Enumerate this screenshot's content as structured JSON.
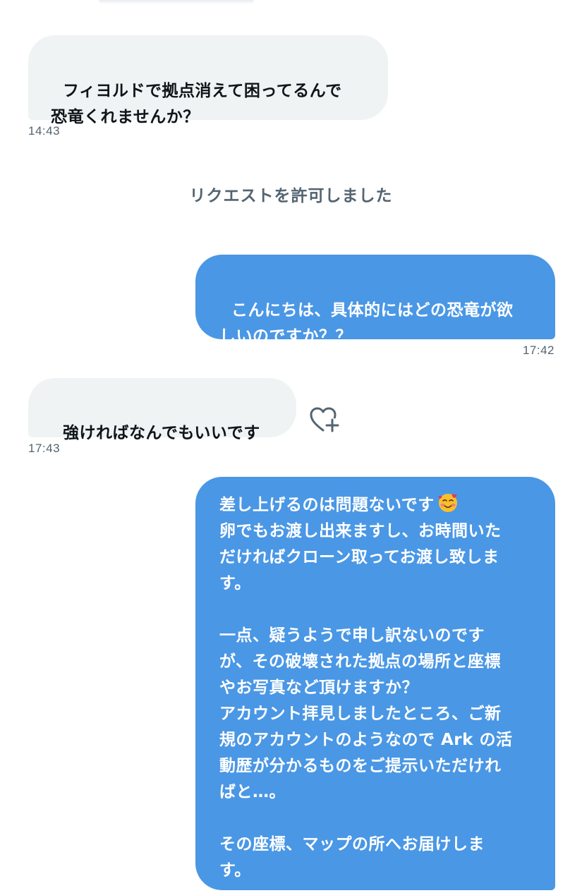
{
  "messages": [
    {
      "direction": "incoming",
      "text": "フィヨルドで拠点消えて困ってるんで\n恐竜くれませんか？",
      "time": "14:43"
    },
    {
      "direction": "outgoing",
      "text": "こんにちは、具体的にはどの恐竜が欲\nしいのですか？？",
      "time": "17:42"
    },
    {
      "direction": "incoming",
      "text": "強ければなんでもいいです",
      "time": "17:43"
    },
    {
      "direction": "outgoing",
      "text_before_emoji": "差し上げるのは問題ないです",
      "emoji": "smiling-face-with-hearts",
      "text_after_emoji": "\n卵でもお渡し出来ますし、お時間いた\nだければクローン取ってお渡し致しま\nす。\n\n一点、疑うようで申し訳ないのです\nが、その破壊された拠点の場所と座標\nやお写真など頂けますか？\nアカウント拝見しましたところ、ご新\n規のアカウントのようなので Ark の活\n動歴が分かるものをご提示いただけれ\nばと…。\n\nその座標、マップの所へお届けしま\nす。"
    }
  ],
  "system_note": "リクエストを許可しました",
  "reaction_icon": "heart-plus-icon",
  "colors": {
    "incoming_bubble": "#eff3f4",
    "outgoing_bubble": "#4a97e5",
    "timestamp": "#536471"
  }
}
